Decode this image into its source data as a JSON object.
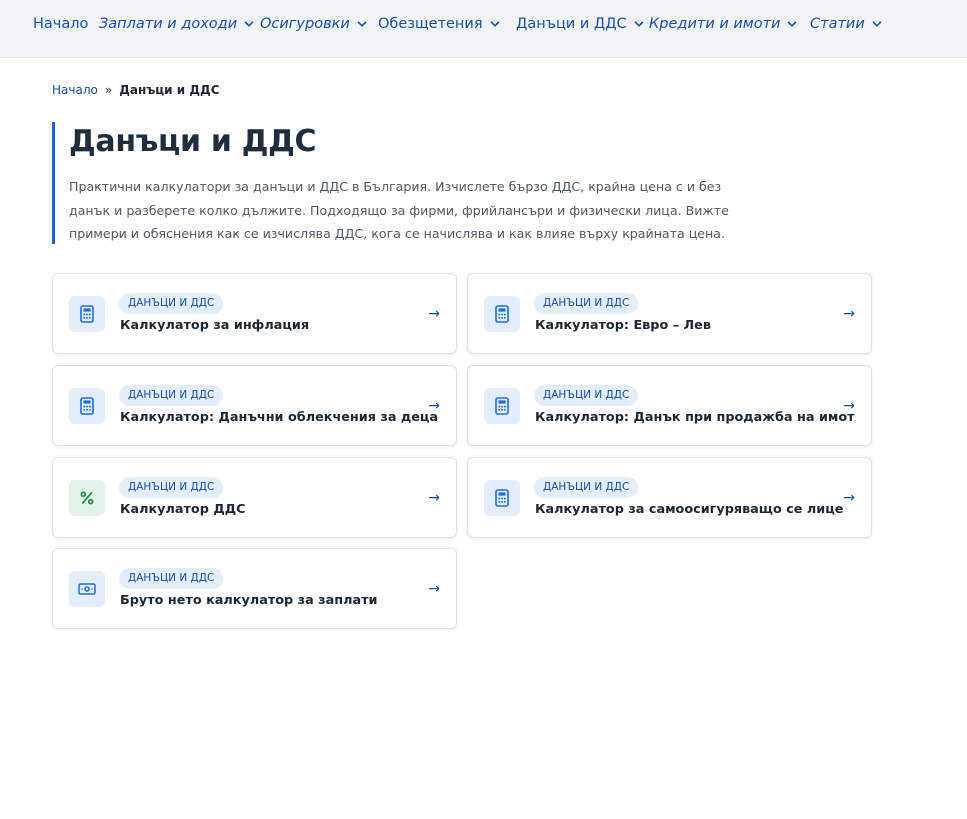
{
  "nav": {
    "items": [
      {
        "label": "Начало",
        "has_dropdown": false
      },
      {
        "label": "Заплати и доходи",
        "has_dropdown": true
      },
      {
        "label": "Осигуровки",
        "has_dropdown": true
      },
      {
        "label": "Обезщетения",
        "has_dropdown": true
      },
      {
        "label": "Данъци и ДДС",
        "has_dropdown": true
      },
      {
        "label": "Кредити и имоти",
        "has_dropdown": true
      },
      {
        "label": "Статии",
        "has_dropdown": true
      }
    ]
  },
  "breadcrumb": {
    "home": "Начало",
    "separator": "»",
    "current": "Данъци и ДДС"
  },
  "hero": {
    "title": "Данъци и ДДС",
    "description": "Практични калкулатори за данъци и ДДС в България. Изчислете бързо ДДС, крайна цена с и без данък и разберете колко дължите. Подходящо за фирми, фрийлансъри и физически лица. Вижте примери и обяснения как се изчислява ДДС, кога се начислява и как влияе върху крайната цена."
  },
  "cards": [
    {
      "badge": "ДАНЪЦИ И ДДС",
      "title": "Калкулатор за инфлация",
      "icon": "calculator-icon",
      "arrow": "→"
    },
    {
      "badge": "ДАНЪЦИ И ДДС",
      "title": "Калкулатор: Евро – Лев",
      "icon": "calculator-icon",
      "arrow": "→"
    },
    {
      "badge": "ДАНЪЦИ И ДДС",
      "title": "Калкулатор: Данъчни облекчения за деца",
      "icon": "calculator-icon",
      "arrow": "→"
    },
    {
      "badge": "ДАНЪЦИ И ДДС",
      "title": "Калкулатор: Данък при продажба на имот",
      "icon": "calculator-icon",
      "arrow": "→"
    },
    {
      "badge": "ДАНЪЦИ И ДДС",
      "title": "Калкулатор ДДС",
      "icon": "percent-icon",
      "arrow": "→"
    },
    {
      "badge": "ДАНЪЦИ И ДДС",
      "title": "Калкулатор за самоосигуряващо се лице",
      "icon": "calculator-icon",
      "arrow": "→"
    },
    {
      "badge": "ДАНЪЦИ И ДДС",
      "title": "Бруто нето калкулатор за заплати",
      "icon": "banknote-icon",
      "arrow": "→"
    }
  ],
  "colors": {
    "accent": "#174ea6",
    "accent_bar": "#2563cc",
    "nav_bg": "#f0f4f7",
    "badge_bg": "#e4eefb",
    "icon_green": "#1f8a4c"
  }
}
